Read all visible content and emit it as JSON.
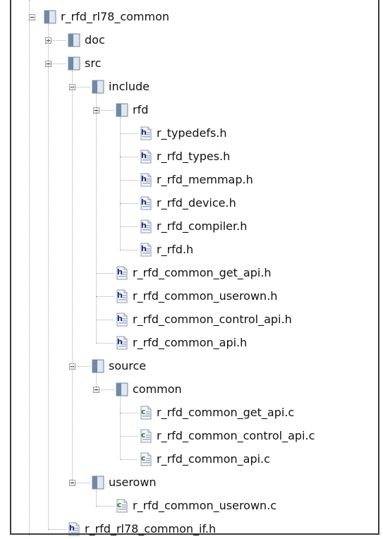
{
  "tree": [
    {
      "label": "r_rfd_rl78_common",
      "type": "folder",
      "expanded": true,
      "children": [
        {
          "label": "doc",
          "type": "folder",
          "expanded": false,
          "children": []
        },
        {
          "label": "src",
          "type": "folder",
          "expanded": true,
          "children": [
            {
              "label": "include",
              "type": "folder",
              "expanded": true,
              "children": [
                {
                  "label": "rfd",
                  "type": "folder",
                  "expanded": true,
                  "children": [
                    {
                      "label": "r_typedefs.h",
                      "type": "h"
                    },
                    {
                      "label": "r_rfd_types.h",
                      "type": "h"
                    },
                    {
                      "label": "r_rfd_memmap.h",
                      "type": "h"
                    },
                    {
                      "label": "r_rfd_device.h",
                      "type": "h"
                    },
                    {
                      "label": "r_rfd_compiler.h",
                      "type": "h"
                    },
                    {
                      "label": "r_rfd.h",
                      "type": "h"
                    }
                  ]
                },
                {
                  "label": "r_rfd_common_get_api.h",
                  "type": "h"
                },
                {
                  "label": "r_rfd_common_userown.h",
                  "type": "h"
                },
                {
                  "label": "r_rfd_common_control_api.h",
                  "type": "h"
                },
                {
                  "label": "r_rfd_common_api.h",
                  "type": "h"
                }
              ]
            },
            {
              "label": "source",
              "type": "folder",
              "expanded": true,
              "children": [
                {
                  "label": "common",
                  "type": "folder",
                  "expanded": true,
                  "children": [
                    {
                      "label": "r_rfd_common_get_api.c",
                      "type": "c"
                    },
                    {
                      "label": "r_rfd_common_control_api.c",
                      "type": "c"
                    },
                    {
                      "label": "r_rfd_common_api.c",
                      "type": "c"
                    }
                  ]
                }
              ]
            },
            {
              "label": "userown",
              "type": "folder",
              "expanded": true,
              "children": [
                {
                  "label": "r_rfd_common_userown.c",
                  "type": "c"
                }
              ]
            }
          ]
        },
        {
          "label": "r_rfd_rl78_common_if.h",
          "type": "h"
        }
      ]
    }
  ],
  "colors": {
    "folder_face": "#c7d3df",
    "folder_spine": "#6f8aa6",
    "header_letter": "#1f2d8c",
    "source_letter": "#2e8b2e",
    "tree_lines": "#a8a8a8"
  },
  "icons": {
    "folder": "folder-icon",
    "h": "header-file-icon",
    "c": "c-source-file-icon",
    "expanded": "expander-minus-icon",
    "collapsed": "expander-plus-icon"
  }
}
